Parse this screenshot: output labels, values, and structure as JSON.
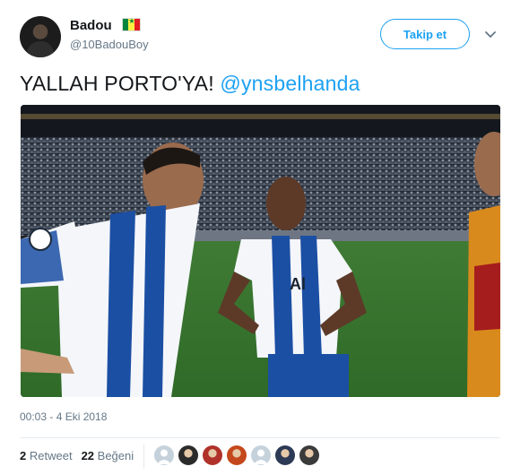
{
  "user": {
    "display_name": "Badou",
    "handle": "@10BadouBoy",
    "flag_icon": "senegal-flag-icon"
  },
  "actions": {
    "follow_label": "Takip et",
    "menu_icon": "chevron-down-icon"
  },
  "tweet": {
    "text": "YALLAH PORTO'YA! ",
    "mention": "@ynsbelhanda"
  },
  "meta": {
    "timestamp": "00:03 - 4 Eki 2018"
  },
  "stats": {
    "retweet_count": "2",
    "retweet_label": "Retweet",
    "like_count": "22",
    "like_label": "Beğeni"
  },
  "likers": [
    {
      "kind": "default",
      "color": "#c6d2db"
    },
    {
      "kind": "photo",
      "color": "#2b2b2b"
    },
    {
      "kind": "photo",
      "color": "#b0322b"
    },
    {
      "kind": "photo",
      "color": "#c4481c"
    },
    {
      "kind": "default",
      "color": "#c6d2db"
    },
    {
      "kind": "photo",
      "color": "#2d3a56"
    },
    {
      "kind": "photo",
      "color": "#3b3b3b"
    }
  ],
  "colors": {
    "accent": "#1da1f2",
    "text_primary": "#14171a",
    "text_secondary": "#657786"
  }
}
